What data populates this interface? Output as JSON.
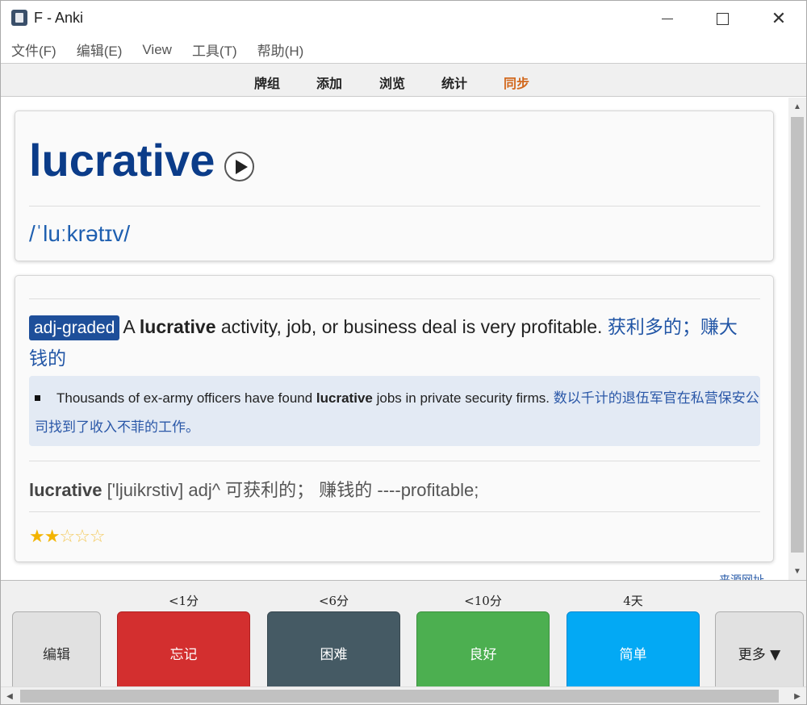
{
  "window": {
    "title": "F - Anki",
    "minimize": "",
    "maximize": "",
    "close": "✕"
  },
  "menu": [
    "文件(F)",
    "编辑(E)",
    "View",
    "工具(T)",
    "帮助(H)"
  ],
  "toolbar": {
    "decks": "牌组",
    "add": "添加",
    "browse": "浏览",
    "stats": "统计",
    "sync": "同步",
    "sync_color": "#d2691e"
  },
  "card": {
    "word": "lucrative",
    "phonetic": "/ˈluːkrətɪv/",
    "tag": "adj-graded",
    "def_pre": "A ",
    "def_word": "lucrative",
    "def_post": " activity, job, or business deal is very profitable.  ",
    "def_zh": "获利多的；赚大钱的",
    "example_pre": "Thousands of ex-army officers have found ",
    "example_word": "lucrative",
    "example_post": " jobs in private security firms. ",
    "example_zh": "数以千计的退伍军官在私营保安公司找到了收入不菲的工作。",
    "dict_word": "lucrative",
    "dict_rest": " ['ljuikrstiv] adj^ 可获利的；  赚钱的 ----profitable;",
    "stars_filled": "★★",
    "stars_empty": "☆☆☆",
    "rating": 2,
    "rating_max": 5,
    "source_link": "来源网址"
  },
  "answer_bar": {
    "edit": "编辑",
    "more": "更多 ▼",
    "buttons": [
      {
        "interval": "<1分",
        "label": "忘记"
      },
      {
        "interval": "<6分",
        "label": "困难"
      },
      {
        "interval": "<10分",
        "label": "良好"
      },
      {
        "interval": "4天",
        "label": "简单"
      }
    ]
  },
  "scrollbars": {
    "up": "▲",
    "down": "▼",
    "left": "◀",
    "right": "▶"
  }
}
